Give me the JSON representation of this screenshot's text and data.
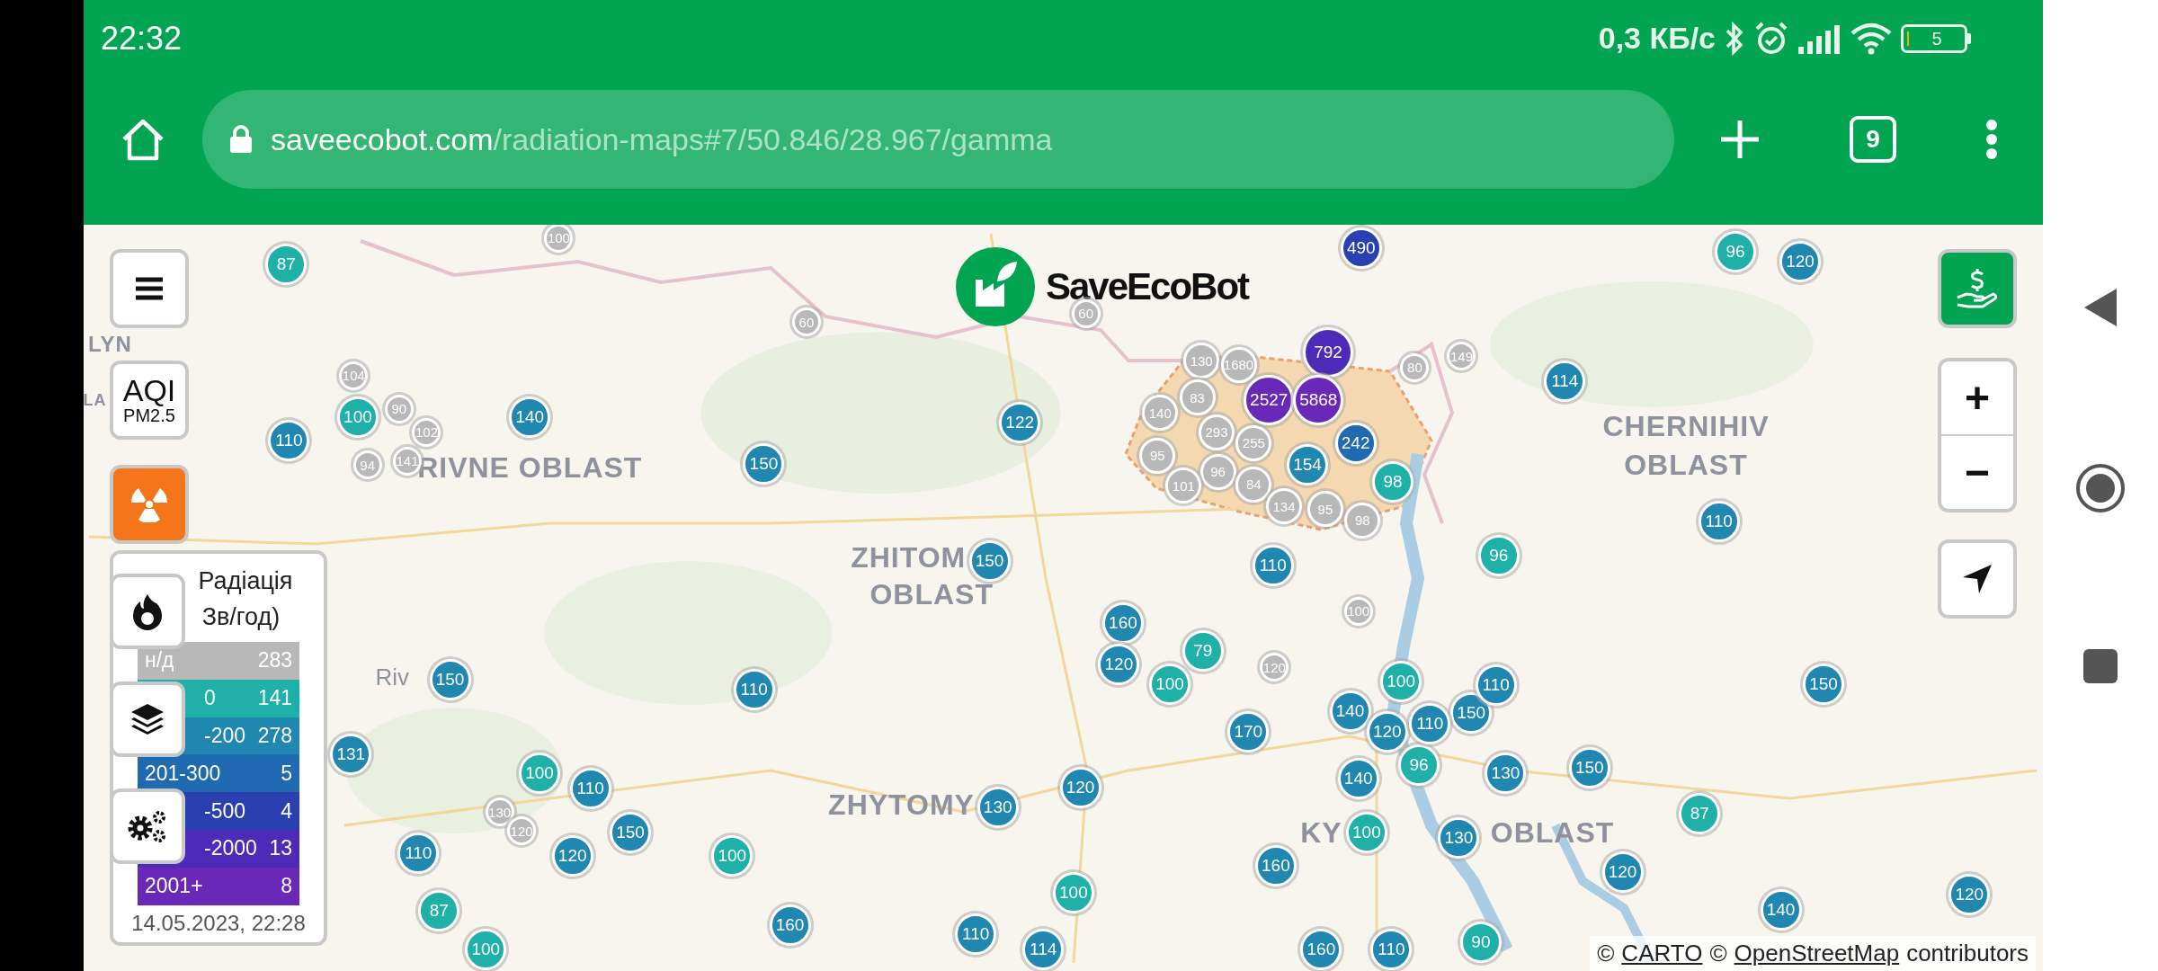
{
  "status_bar": {
    "time": "22:32",
    "net_speed": "0,3 КБ/с",
    "battery": "5"
  },
  "browser": {
    "url_host": "saveecobot.com",
    "url_path": "/radiation-maps#7/50.846/28.967/gamma",
    "tab_count": "9"
  },
  "map": {
    "logo": "SaveEcoBot",
    "place_labels": [
      {
        "text": "LYN"
      },
      {
        "text": "LA"
      },
      {
        "text": "CHERNIHIV"
      },
      {
        "text": "RIVNE OBLAST"
      },
      {
        "text": "OBLAST"
      },
      {
        "text": "ZHITOM"
      },
      {
        "text": "OBLAST"
      },
      {
        "text": "Riv"
      },
      {
        "text": "ZHYTOMY"
      },
      {
        "text": "KY"
      },
      {
        "text": "OBLAST"
      }
    ],
    "markers": [
      {
        "value": "87",
        "color": "#1fb0a8"
      },
      {
        "value": "100",
        "color": "#b8b8b8"
      },
      {
        "value": "490",
        "color": "#2a40b0"
      },
      {
        "value": "96",
        "color": "#1fb0a8"
      },
      {
        "value": "120",
        "color": "#1f87b0"
      },
      {
        "value": "60",
        "color": "#b8b8b8"
      },
      {
        "value": "60",
        "color": "#b8b8b8"
      },
      {
        "value": "104",
        "color": "#b8b8b8"
      },
      {
        "value": "130",
        "color": "#b8b8b8"
      },
      {
        "value": "1680",
        "color": "#b8b8b8"
      },
      {
        "value": "792",
        "color": "#4b2bb8"
      },
      {
        "value": "80",
        "color": "#b8b8b8"
      },
      {
        "value": "149",
        "color": "#b8b8b8"
      },
      {
        "value": "114",
        "color": "#1f87b0"
      },
      {
        "value": "100",
        "color": "#1fb0a8"
      },
      {
        "value": "90",
        "color": "#b8b8b8"
      },
      {
        "value": "102",
        "color": "#b8b8b8"
      },
      {
        "value": "140",
        "color": "#1f87b0"
      },
      {
        "value": "122",
        "color": "#1f87b0"
      },
      {
        "value": "140",
        "color": "#b8b8b8"
      },
      {
        "value": "83",
        "color": "#b8b8b8"
      },
      {
        "value": "293",
        "color": "#b8b8b8"
      },
      {
        "value": "2527",
        "color": "#6a28b8"
      },
      {
        "value": "5868",
        "color": "#6a28b8"
      },
      {
        "value": "110",
        "color": "#1f87b0"
      },
      {
        "value": "94",
        "color": "#b8b8b8"
      },
      {
        "value": "141",
        "color": "#b8b8b8"
      },
      {
        "value": "150",
        "color": "#1f87b0"
      },
      {
        "value": "95",
        "color": "#b8b8b8"
      },
      {
        "value": "96",
        "color": "#b8b8b8"
      },
      {
        "value": "255",
        "color": "#b8b8b8"
      },
      {
        "value": "154",
        "color": "#1f87b0"
      },
      {
        "value": "242",
        "color": "#1f6ab0"
      },
      {
        "value": "101",
        "color": "#b8b8b8"
      },
      {
        "value": "84",
        "color": "#b8b8b8"
      },
      {
        "value": "134",
        "color": "#b8b8b8"
      },
      {
        "value": "95",
        "color": "#b8b8b8"
      },
      {
        "value": "98",
        "color": "#1fb0a8"
      },
      {
        "value": "98",
        "color": "#b8b8b8"
      },
      {
        "value": "96",
        "color": "#1fb0a8"
      },
      {
        "value": "110",
        "color": "#1f87b0"
      },
      {
        "value": "150",
        "color": "#1f87b0"
      },
      {
        "value": "110",
        "color": "#1f87b0"
      },
      {
        "value": "160",
        "color": "#1f87b0"
      },
      {
        "value": "100",
        "color": "#b8b8b8"
      },
      {
        "value": "150",
        "color": "#1f87b0"
      },
      {
        "value": "120",
        "color": "#1f87b0"
      },
      {
        "value": "79",
        "color": "#1fb0a8"
      },
      {
        "value": "120",
        "color": "#b8b8b8"
      },
      {
        "value": "110",
        "color": "#1f87b0"
      },
      {
        "value": "100",
        "color": "#1fb0a8"
      },
      {
        "value": "140",
        "color": "#1f87b0"
      },
      {
        "value": "100",
        "color": "#1fb0a8"
      },
      {
        "value": "150",
        "color": "#1f87b0"
      },
      {
        "value": "110",
        "color": "#1f87b0"
      },
      {
        "value": "150",
        "color": "#1f87b0"
      },
      {
        "value": "131",
        "color": "#1f87b0"
      },
      {
        "value": "170",
        "color": "#1f87b0"
      },
      {
        "value": "120",
        "color": "#1f87b0"
      },
      {
        "value": "110",
        "color": "#1f87b0"
      },
      {
        "value": "100",
        "color": "#1fb0a8"
      },
      {
        "value": "110",
        "color": "#1f87b0"
      },
      {
        "value": "120",
        "color": "#1f87b0"
      },
      {
        "value": "140",
        "color": "#1f87b0"
      },
      {
        "value": "96",
        "color": "#1fb0a8"
      },
      {
        "value": "130",
        "color": "#1f87b0"
      },
      {
        "value": "150",
        "color": "#1f87b0"
      },
      {
        "value": "130",
        "color": "#b8b8b8"
      },
      {
        "value": "120",
        "color": "#b8b8b8"
      },
      {
        "value": "150",
        "color": "#1f87b0"
      },
      {
        "value": "130",
        "color": "#1f87b0"
      },
      {
        "value": "100",
        "color": "#1fb0a8"
      },
      {
        "value": "130",
        "color": "#1f87b0"
      },
      {
        "value": "87",
        "color": "#1fb0a8"
      },
      {
        "value": "110",
        "color": "#1f87b0"
      },
      {
        "value": "120",
        "color": "#1f87b0"
      },
      {
        "value": "100",
        "color": "#1fb0a8"
      },
      {
        "value": "160",
        "color": "#1f87b0"
      },
      {
        "value": "120",
        "color": "#1f87b0"
      },
      {
        "value": "87",
        "color": "#1fb0a8"
      },
      {
        "value": "160",
        "color": "#1f87b0"
      },
      {
        "value": "100",
        "color": "#1fb0a8"
      },
      {
        "value": "140",
        "color": "#1f87b0"
      },
      {
        "value": "120",
        "color": "#1f87b0"
      },
      {
        "value": "100",
        "color": "#1fb0a8"
      },
      {
        "value": "110",
        "color": "#1f87b0"
      },
      {
        "value": "114",
        "color": "#1f87b0"
      },
      {
        "value": "160",
        "color": "#1f87b0"
      },
      {
        "value": "110",
        "color": "#1f87b0"
      },
      {
        "value": "90",
        "color": "#1fb0a8"
      }
    ],
    "aqi_button": {
      "title": "AQI",
      "subtitle": "PM2.5",
      "selected": false
    },
    "radiation_button": {
      "selected": true
    },
    "legend": {
      "title": "Радіація",
      "unit": "Зв/год)",
      "rows": [
        {
          "label": "н/д",
          "count": "283",
          "color": "#b8b8b8"
        },
        {
          "label": "0",
          "count": "141",
          "color": "#1fb0a8"
        },
        {
          "label": "-200",
          "count": "278",
          "color": "#1f87b0"
        },
        {
          "label": "201-300",
          "count": "5",
          "color": "#1f6ab0"
        },
        {
          "label": "-500",
          "count": "4",
          "color": "#2a40b0"
        },
        {
          "label": "-2000",
          "count": "13",
          "color": "#4b2bb8"
        },
        {
          "label": "2001+",
          "count": "8",
          "color": "#6a28b8"
        }
      ],
      "updated": "14.05.2023, 22:28"
    },
    "zoom_in": "+",
    "zoom_out": "−",
    "attribution": [
      {
        "text": "©",
        "link": false
      },
      {
        "text": "CARTO",
        "link": true
      },
      {
        "text": "©",
        "link": false
      },
      {
        "text": "OpenStreetMap",
        "link": true
      },
      {
        "text": "contributors",
        "link": false
      }
    ]
  }
}
